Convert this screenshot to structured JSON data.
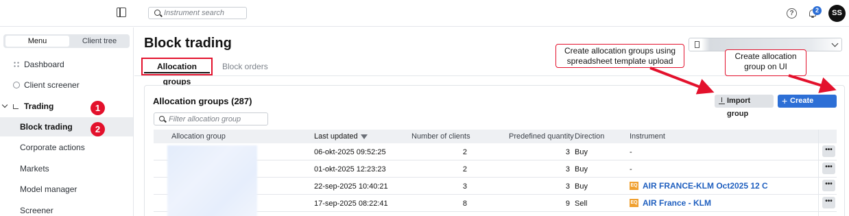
{
  "search": {
    "placeholder": "Instrument search"
  },
  "notifications": {
    "count": "2"
  },
  "user": {
    "initials": "SS"
  },
  "sidebar": {
    "segments": {
      "active": "Menu",
      "other": "Client tree"
    },
    "items": [
      {
        "label": "Dashboard",
        "icon": "dashboard-icon"
      },
      {
        "label": "Client screener",
        "icon": "person-icon"
      },
      {
        "label": "Trading",
        "icon": "trading-icon"
      },
      {
        "label": "Block trading"
      },
      {
        "label": "Corporate actions"
      },
      {
        "label": "Markets"
      },
      {
        "label": "Model manager"
      },
      {
        "label": "Screener"
      }
    ],
    "steps": [
      "1",
      "2"
    ]
  },
  "page": {
    "title": "Block trading",
    "tabs": [
      {
        "label": "Allocation groups"
      },
      {
        "label": "Block orders"
      }
    ]
  },
  "callouts": {
    "import": "Create allocation groups using spreadsheet template upload",
    "create": "Create allocation group on UI"
  },
  "panel": {
    "title": "Allocation groups (287)",
    "filter_placeholder": "Filter allocation group",
    "import_label": "Import group",
    "create_label": "Create group"
  },
  "table": {
    "columns": [
      "Allocation group",
      "Last updated",
      "Number of clients",
      "Predefined quantity",
      "Direction",
      "Instrument"
    ],
    "rows": [
      {
        "last_updated": "06-okt-2025 09:52:25",
        "clients": "2",
        "quantity": "3",
        "direction": "Buy",
        "instrument": "-"
      },
      {
        "last_updated": "01-okt-2025 12:23:23",
        "clients": "2",
        "quantity": "3",
        "direction": "Buy",
        "instrument": "-"
      },
      {
        "last_updated": "22-sep-2025 10:40:21",
        "clients": "3",
        "quantity": "3",
        "direction": "Buy",
        "instrument": "AIR FRANCE-KLM Oct2025 12 C"
      },
      {
        "last_updated": "17-sep-2025 08:22:41",
        "clients": "8",
        "quantity": "9",
        "direction": "Sell",
        "instrument": "AIR France - KLM"
      }
    ],
    "more_label": "•••"
  },
  "colors": {
    "accent": "#2d6fd6",
    "annotation": "#e3112c",
    "link": "#1f5fbf"
  }
}
